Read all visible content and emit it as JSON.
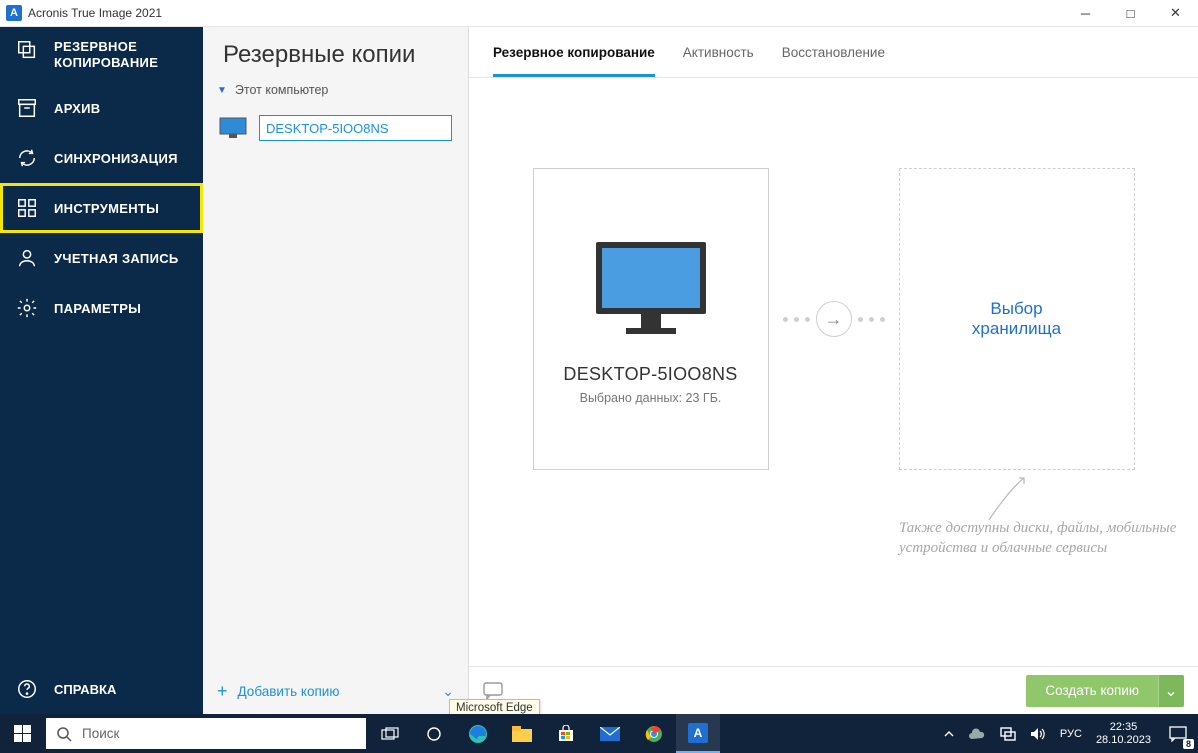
{
  "window": {
    "title": "Acronis True Image 2021",
    "logo_letter": "A"
  },
  "nav": {
    "backup": "РЕЗЕРВНОЕ\nКОПИРОВАНИЕ",
    "archive": "АРХИВ",
    "sync": "СИНХРОНИЗАЦИЯ",
    "tools": "ИНСТРУМЕНТЫ",
    "account": "УЧЕТНАЯ ЗАПИСЬ",
    "settings": "ПАРАМЕТРЫ",
    "help": "СПРАВКА"
  },
  "list": {
    "heading": "Резервные копии",
    "group": "Этот компьютер",
    "backup_name": "DESKTOP-5IOO8NS",
    "add_label": "Добавить копию"
  },
  "tabs": {
    "backup": "Резервное копирование",
    "activity": "Активность",
    "recovery": "Восстановление"
  },
  "source_card": {
    "title": "DESKTOP-5IOO8NS",
    "subtitle": "Выбрано данных: 23 ГБ."
  },
  "dest_card": {
    "line1": "Выбор",
    "line2": "хранилища"
  },
  "hint": "Также доступны диски, файлы, мобильные устройства и облачные сервисы",
  "create_button": "Создать копию",
  "tooltip": "Microsoft Edge",
  "taskbar": {
    "search_placeholder": "Поиск",
    "lang": "РУС",
    "time": "22:35",
    "date": "28.10.2023",
    "notif_count": "8"
  }
}
